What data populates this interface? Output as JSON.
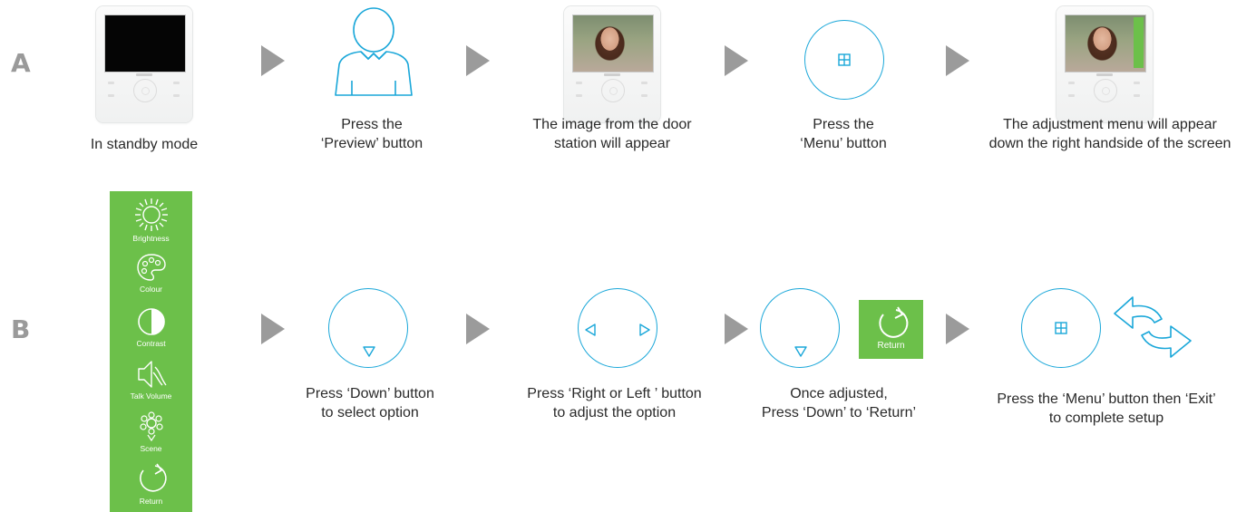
{
  "rows": {
    "a_label": "A",
    "b_label": "B"
  },
  "row_a": {
    "step1_caption": [
      "In standby mode"
    ],
    "step2_caption": [
      "Press the",
      "‘Preview’ button"
    ],
    "step3_caption": [
      "The image from the door",
      "station will appear"
    ],
    "step4_caption": [
      "Press the",
      "‘Menu’ button"
    ],
    "step5_caption": [
      "The adjustment menu will appear",
      "down the right handside of the screen"
    ]
  },
  "menu_panel": {
    "items": [
      {
        "label": "Brightness",
        "icon": "brightness-icon"
      },
      {
        "label": "Colour",
        "icon": "palette-icon"
      },
      {
        "label": "Contrast",
        "icon": "contrast-icon"
      },
      {
        "label": "Talk Volume",
        "icon": "speaker-icon"
      },
      {
        "label": "Scene",
        "icon": "scene-icon"
      },
      {
        "label": "Return",
        "icon": "return-icon"
      }
    ]
  },
  "row_b": {
    "step1_caption": [
      "Press ‘Down’ button",
      "to select option"
    ],
    "step2_caption": [
      "Press ‘Right or Left ’ button",
      "to adjust the option"
    ],
    "step3_caption": [
      "Once adjusted,",
      "Press ‘Down’ to ‘Return’"
    ],
    "step3_return_label": "Return",
    "step4_caption": [
      "Press the ‘Menu’ button then ‘Exit’",
      "to complete setup"
    ]
  },
  "colors": {
    "accent_blue": "#1aa7d9",
    "menu_green": "#6cc04a",
    "arrow_grey": "#9b9b9b",
    "label_grey": "#9a9a9a"
  }
}
